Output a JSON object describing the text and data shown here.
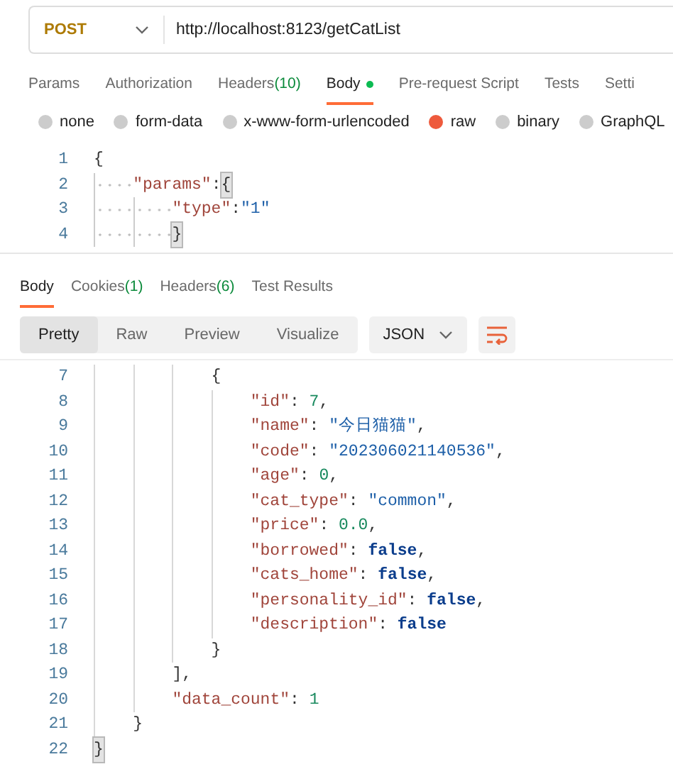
{
  "request": {
    "method": "POST",
    "url": "http://localhost:8123/getCatList"
  },
  "request_tabs": [
    {
      "label": "Params",
      "selected": false
    },
    {
      "label": "Authorization",
      "selected": false
    },
    {
      "label": "Headers",
      "count": "(10)",
      "selected": false
    },
    {
      "label": "Body",
      "dot": true,
      "selected": true
    },
    {
      "label": "Pre-request Script",
      "selected": false
    },
    {
      "label": "Tests",
      "selected": false
    },
    {
      "label": "Setti",
      "selected": false
    }
  ],
  "body_types": [
    {
      "label": "none",
      "selected": false
    },
    {
      "label": "form-data",
      "selected": false
    },
    {
      "label": "x-www-form-urlencoded",
      "selected": false
    },
    {
      "label": "raw",
      "selected": true
    },
    {
      "label": "binary",
      "selected": false
    },
    {
      "label": "GraphQL",
      "selected": false
    }
  ],
  "request_body": [
    {
      "number": "1",
      "tokens": [
        {
          "kind": "punct",
          "text": "{"
        }
      ],
      "children": [
        {
          "number": "2",
          "tokens": [
            {
              "kind": "key",
              "text": "\"params\""
            },
            {
              "kind": "punct",
              "text": ":"
            },
            {
              "kind": "punct",
              "text": "{",
              "highlighted": true
            }
          ],
          "children": [
            {
              "number": "3",
              "tokens": [
                {
                  "kind": "key",
                  "text": "\"type\""
                },
                {
                  "kind": "punct",
                  "text": ":"
                },
                {
                  "kind": "string",
                  "text": "\"1\""
                }
              ]
            },
            {
              "number": "4",
              "tokens": [
                {
                  "kind": "punct",
                  "text": "}",
                  "highlighted": true
                }
              ]
            }
          ]
        }
      ]
    }
  ],
  "response_tabs": [
    {
      "label": "Body",
      "selected": true
    },
    {
      "label": "Cookies",
      "count": "(1)",
      "selected": false
    },
    {
      "label": "Headers",
      "count": "(6)",
      "selected": false
    },
    {
      "label": "Test Results",
      "selected": false
    }
  ],
  "view_modes": [
    {
      "label": "Pretty",
      "selected": true
    },
    {
      "label": "Raw",
      "selected": false
    },
    {
      "label": "Preview",
      "selected": false
    },
    {
      "label": "Visualize",
      "selected": false
    }
  ],
  "format": "JSON",
  "response_body": [
    {
      "children": [
        {
          "children": [
            {
              "children": [
                {
                  "number": "7",
                  "tokens": [
                    {
                      "kind": "punct",
                      "text": "{"
                    }
                  ],
                  "children": [
                    {
                      "number": "8",
                      "tokens": [
                        {
                          "kind": "key",
                          "text": "\"id\""
                        },
                        {
                          "kind": "punct",
                          "text": ": "
                        },
                        {
                          "kind": "number",
                          "text": "7"
                        },
                        {
                          "kind": "punct",
                          "text": ","
                        }
                      ]
                    },
                    {
                      "number": "9",
                      "tokens": [
                        {
                          "kind": "key",
                          "text": "\"name\""
                        },
                        {
                          "kind": "punct",
                          "text": ": "
                        },
                        {
                          "kind": "string",
                          "text": "\"今日猫猫\""
                        },
                        {
                          "kind": "punct",
                          "text": ","
                        }
                      ]
                    },
                    {
                      "number": "10",
                      "tokens": [
                        {
                          "kind": "key",
                          "text": "\"code\""
                        },
                        {
                          "kind": "punct",
                          "text": ": "
                        },
                        {
                          "kind": "string",
                          "text": "\"202306021140536\""
                        },
                        {
                          "kind": "punct",
                          "text": ","
                        }
                      ]
                    },
                    {
                      "number": "11",
                      "tokens": [
                        {
                          "kind": "key",
                          "text": "\"age\""
                        },
                        {
                          "kind": "punct",
                          "text": ": "
                        },
                        {
                          "kind": "number",
                          "text": "0"
                        },
                        {
                          "kind": "punct",
                          "text": ","
                        }
                      ]
                    },
                    {
                      "number": "12",
                      "tokens": [
                        {
                          "kind": "key",
                          "text": "\"cat_type\""
                        },
                        {
                          "kind": "punct",
                          "text": ": "
                        },
                        {
                          "kind": "string",
                          "text": "\"common\""
                        },
                        {
                          "kind": "punct",
                          "text": ","
                        }
                      ]
                    },
                    {
                      "number": "13",
                      "tokens": [
                        {
                          "kind": "key",
                          "text": "\"price\""
                        },
                        {
                          "kind": "punct",
                          "text": ": "
                        },
                        {
                          "kind": "number",
                          "text": "0.0"
                        },
                        {
                          "kind": "punct",
                          "text": ","
                        }
                      ]
                    },
                    {
                      "number": "14",
                      "tokens": [
                        {
                          "kind": "key",
                          "text": "\"borrowed\""
                        },
                        {
                          "kind": "punct",
                          "text": ": "
                        },
                        {
                          "kind": "bool",
                          "text": "false"
                        },
                        {
                          "kind": "punct",
                          "text": ","
                        }
                      ]
                    },
                    {
                      "number": "15",
                      "tokens": [
                        {
                          "kind": "key",
                          "text": "\"cats_home\""
                        },
                        {
                          "kind": "punct",
                          "text": ": "
                        },
                        {
                          "kind": "bool",
                          "text": "false"
                        },
                        {
                          "kind": "punct",
                          "text": ","
                        }
                      ]
                    },
                    {
                      "number": "16",
                      "tokens": [
                        {
                          "kind": "key",
                          "text": "\"personality_id\""
                        },
                        {
                          "kind": "punct",
                          "text": ": "
                        },
                        {
                          "kind": "bool",
                          "text": "false"
                        },
                        {
                          "kind": "punct",
                          "text": ","
                        }
                      ]
                    },
                    {
                      "number": "17",
                      "tokens": [
                        {
                          "kind": "key",
                          "text": "\"description\""
                        },
                        {
                          "kind": "punct",
                          "text": ": "
                        },
                        {
                          "kind": "bool",
                          "text": "false"
                        }
                      ]
                    }
                  ]
                },
                {
                  "number": "18",
                  "tokens": [
                    {
                      "kind": "punct",
                      "text": "}"
                    }
                  ]
                }
              ]
            },
            {
              "number": "19",
              "tokens": [
                {
                  "kind": "punct",
                  "text": "],"
                }
              ]
            },
            {
              "number": "20",
              "tokens": [
                {
                  "kind": "key",
                  "text": "\"data_count\""
                },
                {
                  "kind": "punct",
                  "text": ": "
                },
                {
                  "kind": "number",
                  "text": "1"
                }
              ]
            }
          ]
        },
        {
          "number": "21",
          "tokens": [
            {
              "kind": "punct",
              "text": "}"
            }
          ]
        }
      ]
    },
    {
      "number": "22",
      "tokens": [
        {
          "kind": "punct",
          "text": "}",
          "highlighted": true
        }
      ]
    }
  ]
}
